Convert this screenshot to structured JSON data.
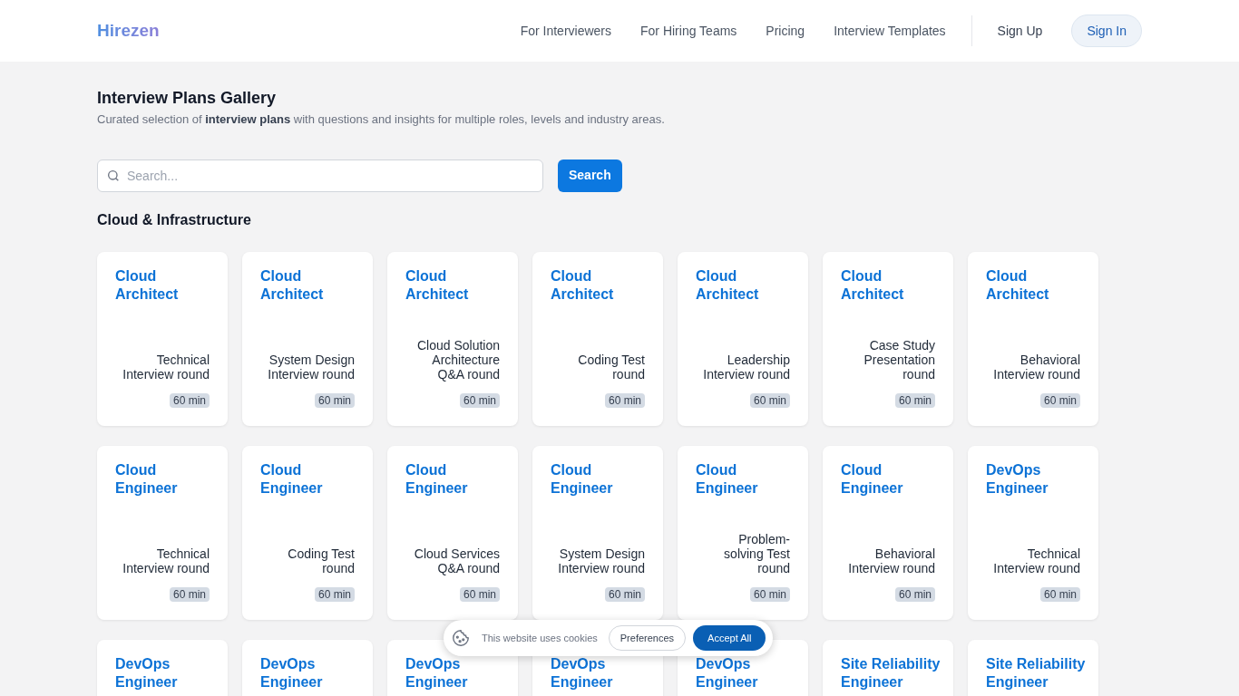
{
  "header": {
    "logo": "Hirezen",
    "nav": [
      "For Interviewers",
      "For Hiring Teams",
      "Pricing",
      "Interview Templates"
    ],
    "sign_up": "Sign Up",
    "sign_in": "Sign In"
  },
  "page": {
    "title": "Interview Plans Gallery",
    "subtitle": "Curated selection of **interview plans** with questions and insights for multiple roles, levels and industry areas."
  },
  "search": {
    "placeholder": "Search...",
    "button": "Search"
  },
  "section": "Cloud & Infrastructure",
  "cards": [
    {
      "title": "Cloud Architect",
      "round": "Technical Interview round",
      "duration": "60 min"
    },
    {
      "title": "Cloud Architect",
      "round": "System Design Interview round",
      "duration": "60 min"
    },
    {
      "title": "Cloud Architect",
      "round": "Cloud Solution Architecture Q&A round",
      "duration": "60 min"
    },
    {
      "title": "Cloud Architect",
      "round": "Coding Test round",
      "duration": "60 min"
    },
    {
      "title": "Cloud Architect",
      "round": "Leadership Interview round",
      "duration": "60 min"
    },
    {
      "title": "Cloud Architect",
      "round": "Case Study Presentation round",
      "duration": "60 min"
    },
    {
      "title": "Cloud Architect",
      "round": "Behavioral Interview round",
      "duration": "60 min"
    },
    {
      "title": "Cloud Engineer",
      "round": "Technical Interview round",
      "duration": "60 min"
    },
    {
      "title": "Cloud Engineer",
      "round": "Coding Test round",
      "duration": "60 min"
    },
    {
      "title": "Cloud Engineer",
      "round": "Cloud Services Q&A round",
      "duration": "60 min"
    },
    {
      "title": "Cloud Engineer",
      "round": "System Design Interview round",
      "duration": "60 min"
    },
    {
      "title": "Cloud Engineer",
      "round": "Problem-solving Test round",
      "duration": "60 min"
    },
    {
      "title": "Cloud Engineer",
      "round": "Behavioral Interview round",
      "duration": "60 min"
    },
    {
      "title": "DevOps Engineer",
      "round": "Technical Interview round",
      "duration": "60 min"
    },
    {
      "title": "DevOps Engineer"
    },
    {
      "title": "DevOps Engineer"
    },
    {
      "title": "DevOps Engineer"
    },
    {
      "title": "DevOps Engineer"
    },
    {
      "title": "DevOps Engineer"
    },
    {
      "title": "Site Reliability Engineer"
    },
    {
      "title": "Site Reliability Engineer"
    }
  ],
  "cookie_banner": {
    "text": "This website uses cookies",
    "preferences": "Preferences",
    "accept": "Accept All"
  }
}
